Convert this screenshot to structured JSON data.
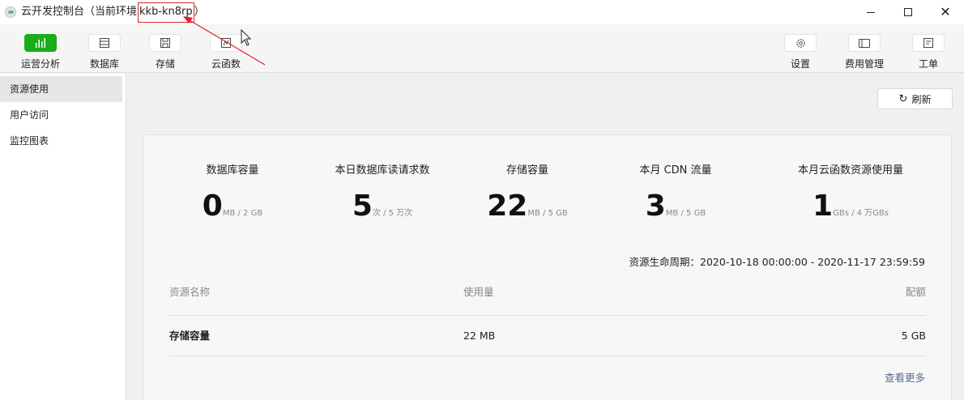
{
  "window": {
    "title": "云开发控制台（当前环境",
    "env_id": "kkb-kn8rp",
    "title_suffix": "）",
    "controls": {
      "minimize": "",
      "maximize": "",
      "close": "✕"
    }
  },
  "toolbar": {
    "left": [
      {
        "label": "运营分析",
        "icon": "bar-chart-icon",
        "active": true
      },
      {
        "label": "数据库",
        "icon": "database-icon"
      },
      {
        "label": "存储",
        "icon": "save-icon"
      },
      {
        "label": "云函数",
        "icon": "function-icon"
      }
    ],
    "right": [
      {
        "label": "设置",
        "icon": "gear-icon"
      },
      {
        "label": "费用管理",
        "icon": "billing-icon"
      },
      {
        "label": "工单",
        "icon": "ticket-icon"
      }
    ]
  },
  "sidebar": {
    "items": [
      {
        "label": "资源使用",
        "active": true
      },
      {
        "label": "用户访问"
      },
      {
        "label": "监控图表"
      }
    ]
  },
  "main": {
    "refresh_label": "刷新",
    "stats": [
      {
        "title": "数据库容量",
        "value": "0",
        "unit": "MB / 2 GB"
      },
      {
        "title": "本日数据库读请求数",
        "value": "5",
        "unit": "次 / 5 万次"
      },
      {
        "title": "存储容量",
        "value": "22",
        "unit": "MB / 5 GB"
      },
      {
        "title": "本月 CDN 流量",
        "value": "3",
        "unit": "MB / 5 GB"
      },
      {
        "title": "本月云函数资源使用量",
        "value": "1",
        "unit": "GBs / 4 万GBs"
      }
    ],
    "lifecycle": "资源生命周期：2020-10-18 00:00:00 - 2020-11-17 23:59:59",
    "table": {
      "headers": [
        "资源名称",
        "使用量",
        "配额"
      ],
      "rows": [
        [
          "存储容量",
          "22 MB",
          "5 GB"
        ]
      ]
    },
    "more_label": "查看更多"
  },
  "colors": {
    "accent": "#1aad19",
    "annotation": "#d9232b",
    "link": "#576b95"
  }
}
